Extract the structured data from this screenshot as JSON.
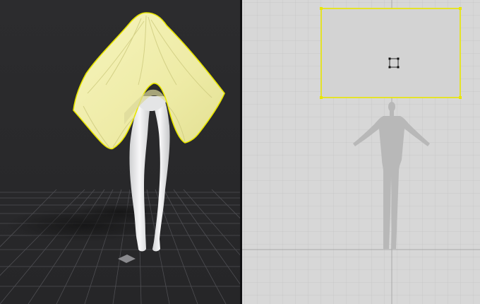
{
  "app": {
    "views": [
      "3d-viewport",
      "2d-pattern-view"
    ]
  },
  "colors": {
    "viewport_3d_bg": "#2b2b2d",
    "floor_grid": "#5a5a5e",
    "cloth_fill": "#f2f0ad",
    "selection_outline": "#e8e600",
    "avatar_fill": "#e9e9ea",
    "pattern_bg": "#d6d6d6",
    "pattern_grid": "#c3c3c3",
    "pattern_piece_fill": "#d2d2d2",
    "avatar_silhouette": "#b9b9b9"
  },
  "icons": [
    "pin-icon",
    "transform-handle-icon"
  ]
}
